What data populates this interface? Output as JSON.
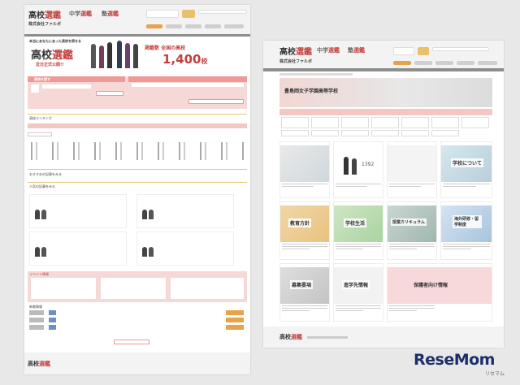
{
  "left_page": {
    "header": {
      "logo_main": "高校",
      "logo_mark": "選鑑",
      "logo_mid": "中学",
      "logo_mid_mark": "選鑑",
      "logo_right": "塾",
      "logo_right_mark": "選鑑",
      "company": "株式会社ファルボ"
    },
    "hero": {
      "tagline": "本当にあなたにあった高校を探せる",
      "brand": "高校",
      "brand_mark": "選鑑",
      "coming": "近日正式公開!!",
      "count_label": "掲載数 全国の高校",
      "count": "1,400",
      "count_unit": "校"
    },
    "search": {
      "title": "高校を探す"
    },
    "ranking": {
      "title": "高校ランキング"
    },
    "articles": {
      "title": "おすすめの記事をみる",
      "recent": "人気の記事をみる"
    },
    "event": {
      "title": "イベント情報"
    },
    "news": {
      "title": "新着情報"
    },
    "footer": {
      "logo": "高校",
      "logo_mark": "選鑑"
    }
  },
  "right_page": {
    "header": {
      "logo_main": "高校",
      "logo_mark": "選鑑",
      "logo_mid": "中学",
      "logo_mid_mark": "選鑑",
      "logo_right": "塾",
      "logo_right_mark": "選鑑",
      "company": "株式会社ファルボ"
    },
    "school": {
      "name": "豊島岡女子学園高等学校"
    },
    "tiles": [
      {
        "label": ""
      },
      {
        "label": ""
      },
      {
        "label": ""
      },
      {
        "label": "学校について"
      },
      {
        "label": "教育方針"
      },
      {
        "label": "学校生活"
      },
      {
        "label": "授業カリキュラム"
      },
      {
        "label": "海外研修・留学制度"
      },
      {
        "label": "募集要項"
      },
      {
        "label": "進学先情報"
      },
      {
        "label": "保護者向け情報"
      }
    ],
    "tile_number": "1392",
    "footer": {
      "logo": "高校",
      "logo_mark": "選鑑"
    }
  },
  "watermark": {
    "main": "ReseMom",
    "sub": "リセマム"
  },
  "colors": {
    "accent": "#c2403c",
    "pink": "#f6d9d6",
    "pink_strong": "#ef9a96",
    "orange": "#e7a24a",
    "brand_navy": "#1b2f6b"
  }
}
